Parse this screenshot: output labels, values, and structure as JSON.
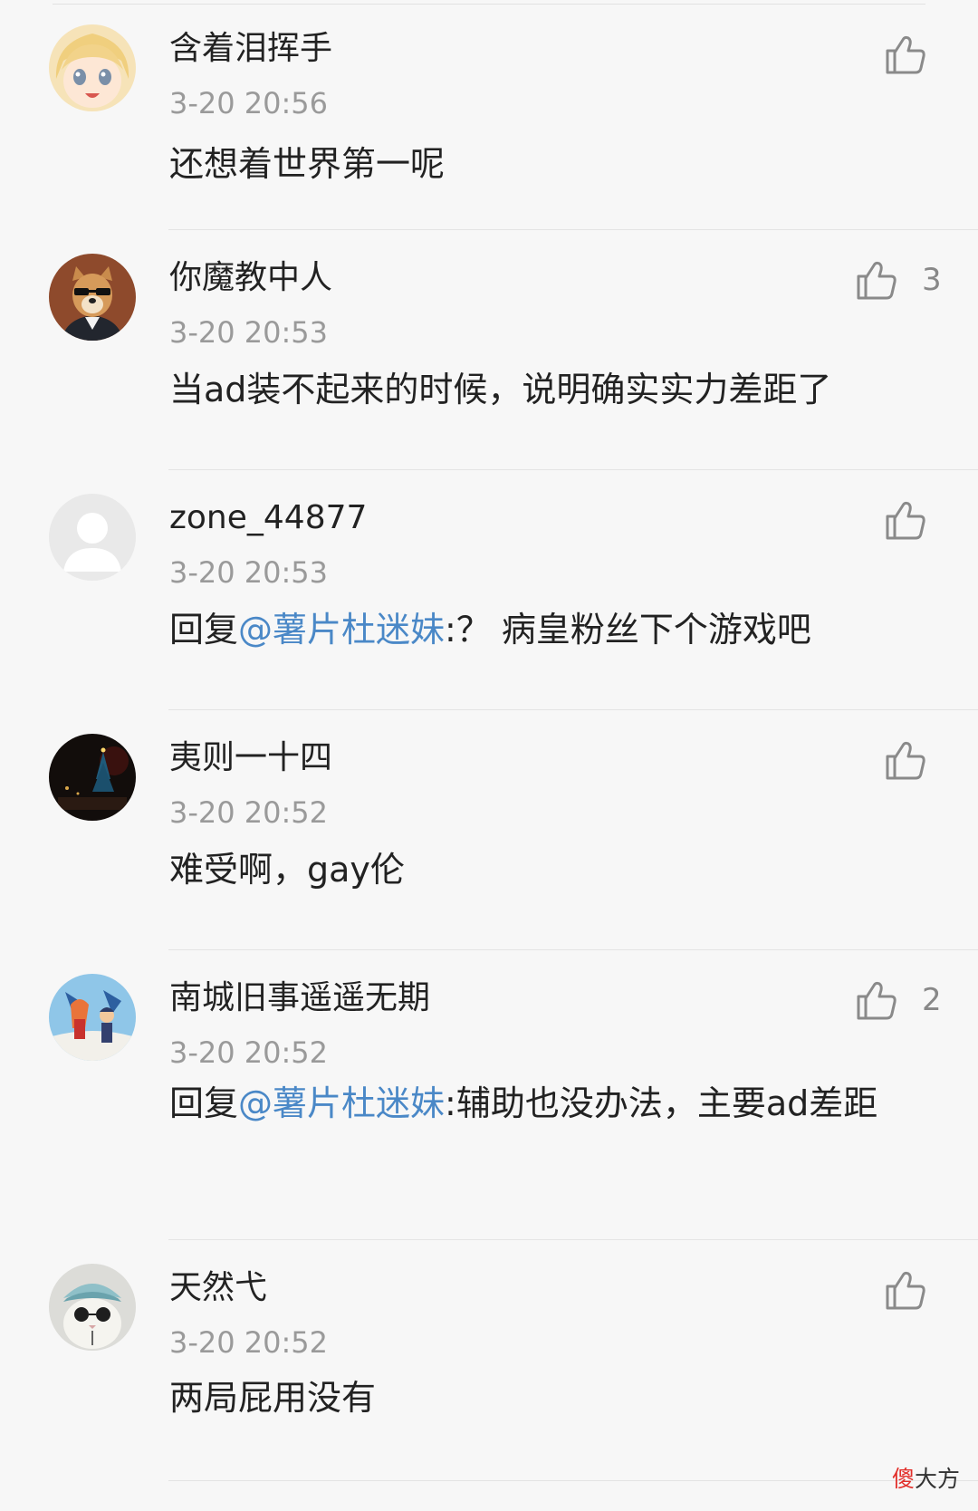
{
  "comments": [
    {
      "username": "含着泪挥手",
      "time": "3-20 20:56",
      "text_before": "",
      "mention": "",
      "text": "还想着世界第一呢",
      "likes": ""
    },
    {
      "username": "你魔教中人",
      "time": "3-20 20:53",
      "text_before": "",
      "mention": "",
      "text": "当ad装不起来的时候，说明确实实力差距了",
      "likes": "3"
    },
    {
      "username": "zone_44877",
      "time": "3-20 20:53",
      "text_before": "回复",
      "mention": "@薯片杜迷妹",
      "text": ":？ 病皇粉丝下个游戏吧",
      "likes": ""
    },
    {
      "username": "夷则一十四",
      "time": "3-20 20:52",
      "text_before": "",
      "mention": "",
      "text": "难受啊，gay伦",
      "likes": ""
    },
    {
      "username": "南城旧事遥遥无期",
      "time": "3-20 20:52",
      "text_before": "回复",
      "mention": "@薯片杜迷妹",
      "text": ":辅助也没办法，主要ad差距",
      "likes": "2"
    },
    {
      "username": "天然弋",
      "time": "3-20 20:52",
      "text_before": "",
      "mention": "",
      "text": "两局屁用没有",
      "likes": ""
    }
  ],
  "watermark": {
    "part1": "傻",
    "part2": "大方"
  },
  "colors": {
    "background": "#f7f7f7",
    "mention": "#4a88c7",
    "meta": "#9a9a9a",
    "watermark_accent": "#e2302b"
  },
  "icons": {
    "like": "thumbs-up-icon"
  }
}
